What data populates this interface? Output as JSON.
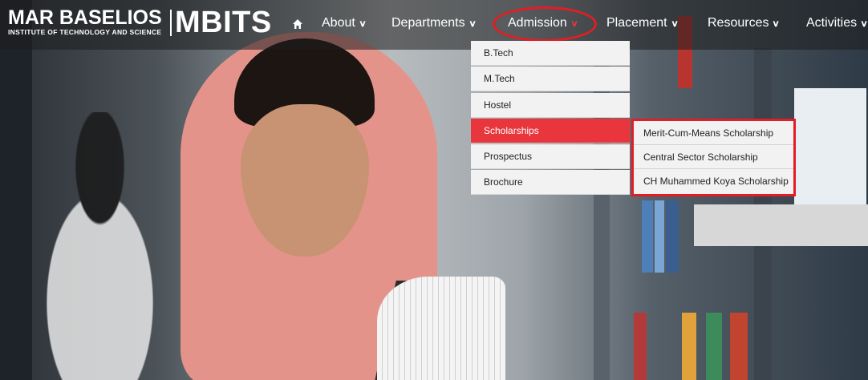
{
  "brand": {
    "name": "MAR BASELIOS",
    "subtitle": "INSTITUTE OF TECHNOLOGY AND SCIENCE",
    "short": "MBITS"
  },
  "nav": {
    "home_icon": "home-icon",
    "items": [
      {
        "label": "About"
      },
      {
        "label": "Departments"
      },
      {
        "label": "Admission"
      },
      {
        "label": "Placement"
      },
      {
        "label": "Resources"
      },
      {
        "label": "Activities"
      }
    ],
    "active": "Admission"
  },
  "admission_menu": {
    "items": [
      {
        "label": "B.Tech"
      },
      {
        "label": "M.Tech"
      },
      {
        "label": "Hostel"
      },
      {
        "label": "Scholarships"
      },
      {
        "label": "Prospectus"
      },
      {
        "label": "Brochure"
      }
    ],
    "highlighted": "Scholarships"
  },
  "scholarships_menu": {
    "items": [
      {
        "label": "Merit-Cum-Means Scholarship"
      },
      {
        "label": "Central Sector Scholarship"
      },
      {
        "label": "CH Muhammed Koya Scholarship"
      }
    ]
  },
  "colors": {
    "accent": "#e8363c",
    "annotation": "#e21d25",
    "nav_text": "#ffffff"
  }
}
